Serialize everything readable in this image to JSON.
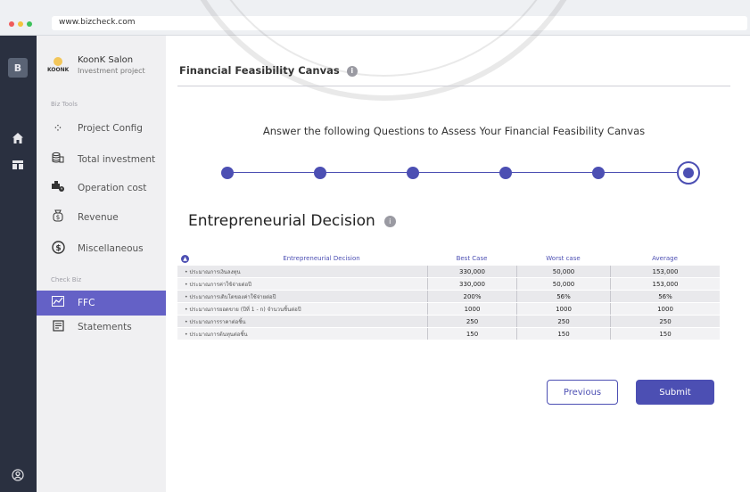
{
  "browser": {
    "url": "www.bizcheck.com"
  },
  "rail": {
    "logo_letter": "B",
    "icons": [
      "home-icon",
      "dashboard-icon",
      "user-circle-icon"
    ]
  },
  "sidebar": {
    "brand": {
      "logo_text": "KOONK",
      "name": "KoonK Salon",
      "subtitle": "Investment project"
    },
    "biz_tools_label": "Biz Tools",
    "check_biz_label": "Check Biz",
    "items": [
      {
        "label": "Project Config",
        "icon": "nodes-icon"
      },
      {
        "label": "Total investment",
        "icon": "coins-icon"
      },
      {
        "label": "Operation cost",
        "icon": "truck-clock-icon"
      },
      {
        "label": "Revenue",
        "icon": "money-bag-icon"
      },
      {
        "label": "Miscellaneous",
        "icon": "dollar-circle-icon"
      },
      {
        "label": "FFC",
        "icon": "chart-icon",
        "active": true
      },
      {
        "label": "Statements",
        "icon": "document-icon"
      }
    ]
  },
  "main": {
    "title": "Financial Feasibility Canvas",
    "prompt": "Answer the following Questions to Assess Your Financial Feasibility Canvas",
    "stepper": {
      "total_steps": 6,
      "current_step": 6
    },
    "section_title": "Entrepreneurial Decision",
    "table": {
      "headers": [
        "Entrepreneurial Decision",
        "Best Case",
        "Worst case",
        "Average"
      ],
      "rows": [
        [
          "• ประมาณการเงินลงทุน",
          "330,000",
          "50,000",
          "153,000"
        ],
        [
          "• ประมาณการค่าใช้จ่ายต่อปี",
          "330,000",
          "50,000",
          "153,000"
        ],
        [
          "• ประมาณการเติบโตของค่าใช้จ่ายต่อปี",
          "200%",
          "56%",
          "56%"
        ],
        [
          "• ประมาณการยอดขาย (ปีที่ 1 - n) จำนวนชิ้นต่อปี",
          "1000",
          "1000",
          "1000"
        ],
        [
          "• ประมาณการราคาต่อชิ้น",
          "250",
          "250",
          "250"
        ],
        [
          "• ประมาณการต้นทุนต่อชิ้น",
          "150",
          "150",
          "150"
        ]
      ]
    },
    "buttons": {
      "previous": "Previous",
      "submit": "Submit"
    }
  },
  "colors": {
    "accent": "#4c4fb3",
    "active_nav": "#6461c6",
    "rail": "#2a3040"
  }
}
